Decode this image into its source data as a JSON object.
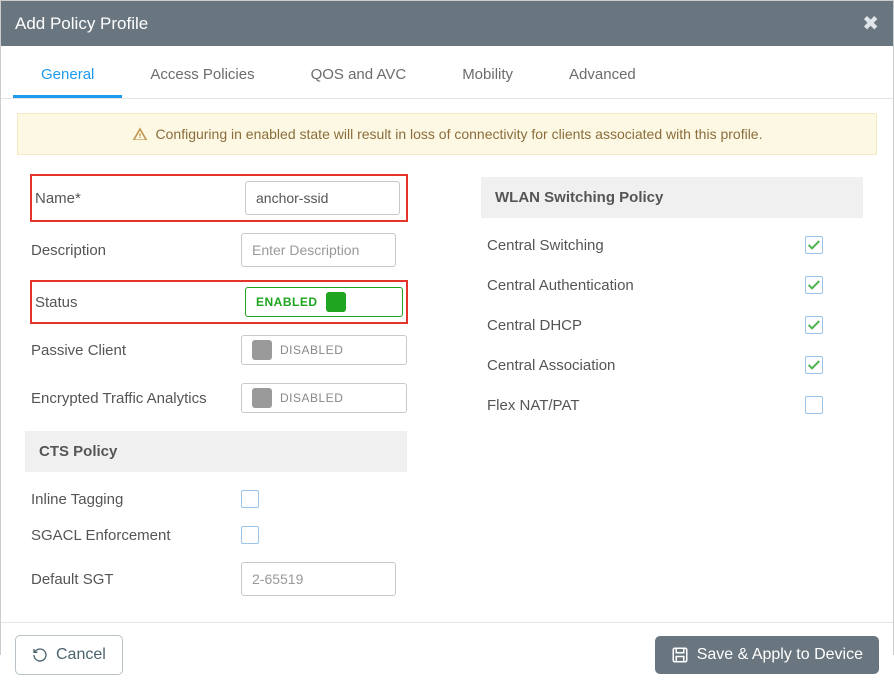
{
  "header": {
    "title": "Add Policy Profile"
  },
  "tabs": {
    "t0": "General",
    "t1": "Access Policies",
    "t2": "QOS and AVC",
    "t3": "Mobility",
    "t4": "Advanced"
  },
  "alert": "Configuring in enabled state will result in loss of connectivity for clients associated with this profile.",
  "left": {
    "name_label": "Name*",
    "name_value": "anchor-ssid",
    "desc_label": "Description",
    "desc_placeholder": "Enter Description",
    "status_label": "Status",
    "status_value": "ENABLED",
    "passive_label": "Passive Client",
    "passive_value": "DISABLED",
    "eta_label": "Encrypted Traffic Analytics",
    "eta_value": "DISABLED",
    "cts_header": "CTS Policy",
    "inline_label": "Inline Tagging",
    "sgacl_label": "SGACL Enforcement",
    "sgt_label": "Default SGT",
    "sgt_placeholder": "2-65519"
  },
  "right": {
    "header": "WLAN Switching Policy",
    "cs_label": "Central Switching",
    "ca_label": "Central Authentication",
    "cd_label": "Central DHCP",
    "cassoc_label": "Central Association",
    "flex_label": "Flex NAT/PAT"
  },
  "footer": {
    "cancel": "Cancel",
    "save": "Save & Apply to Device"
  }
}
